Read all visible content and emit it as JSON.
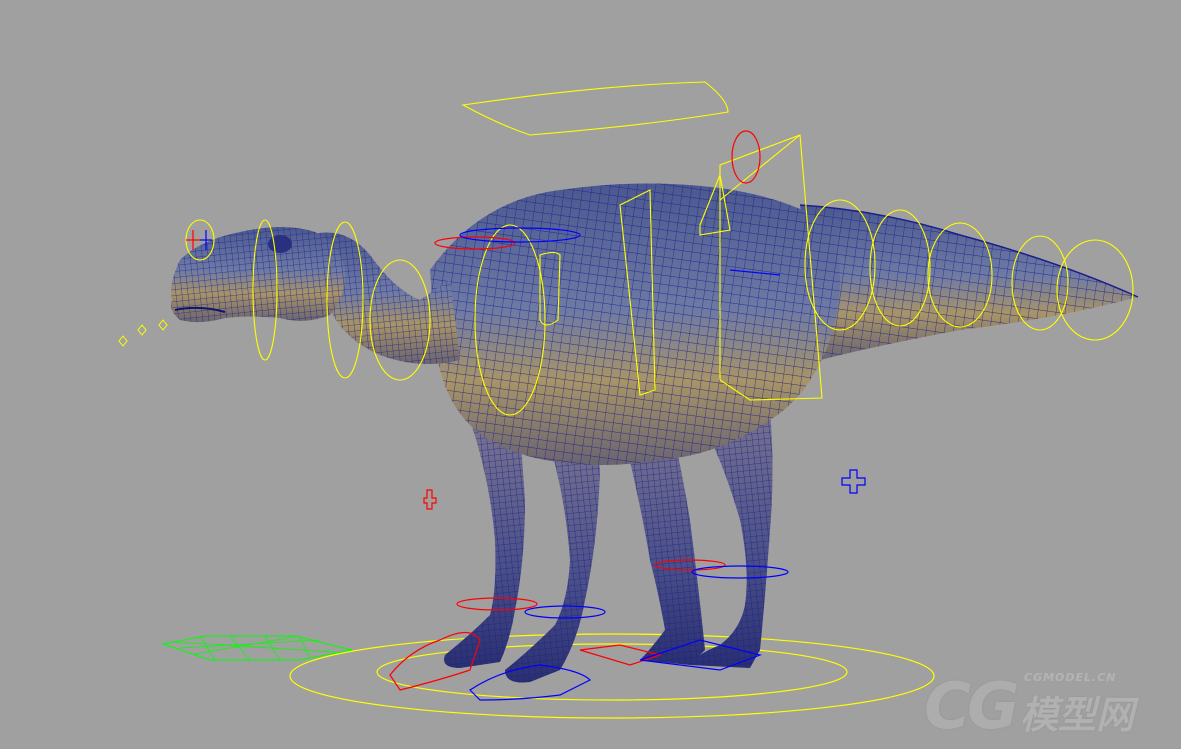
{
  "viewport": {
    "background_color": "#a0a0a0",
    "mesh_color": "#1a1f8c",
    "skin_top_color": "#5a6a9a",
    "skin_belly_color": "#9a8a5a",
    "control_colors": {
      "primary": "#ffff00",
      "left": "#ff0000",
      "right": "#0000ff",
      "root": "#00ff00"
    }
  },
  "watermark": {
    "logo_text": "CG",
    "site_text": "CGMODEL.CN",
    "cn_text": "模型网"
  }
}
